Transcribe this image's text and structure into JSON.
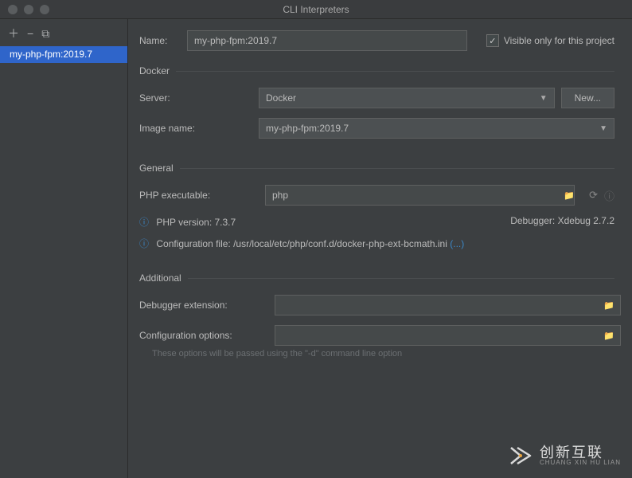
{
  "window": {
    "title": "CLI Interpreters"
  },
  "sidebar": {
    "items": [
      {
        "label": "my-php-fpm:2019.7"
      }
    ]
  },
  "form": {
    "name_label": "Name:",
    "name_value": "my-php-fpm:2019.7",
    "visible_only_label": "Visible only for this project",
    "visible_only_checked": "✓"
  },
  "docker": {
    "legend": "Docker",
    "server_label": "Server:",
    "server_value": "Docker",
    "new_button": "New...",
    "image_label": "Image name:",
    "image_value": "my-php-fpm:2019.7"
  },
  "general": {
    "legend": "General",
    "exec_label": "PHP executable:",
    "exec_value": "php",
    "version_label": "PHP version: 7.3.7",
    "debugger_label": "Debugger: Xdebug 2.7.2",
    "config_label": "Configuration file: /usr/local/etc/php/conf.d/docker-php-ext-bcmath.ini",
    "config_more": "(...)"
  },
  "additional": {
    "legend": "Additional",
    "debugger_ext_label": "Debugger extension:",
    "config_opts_label": "Configuration options:",
    "hint": "These options will be passed using the \"-d\" command line option"
  },
  "watermark": {
    "main": "创新互联",
    "sub": "CHUANG XIN HU LIAN"
  }
}
